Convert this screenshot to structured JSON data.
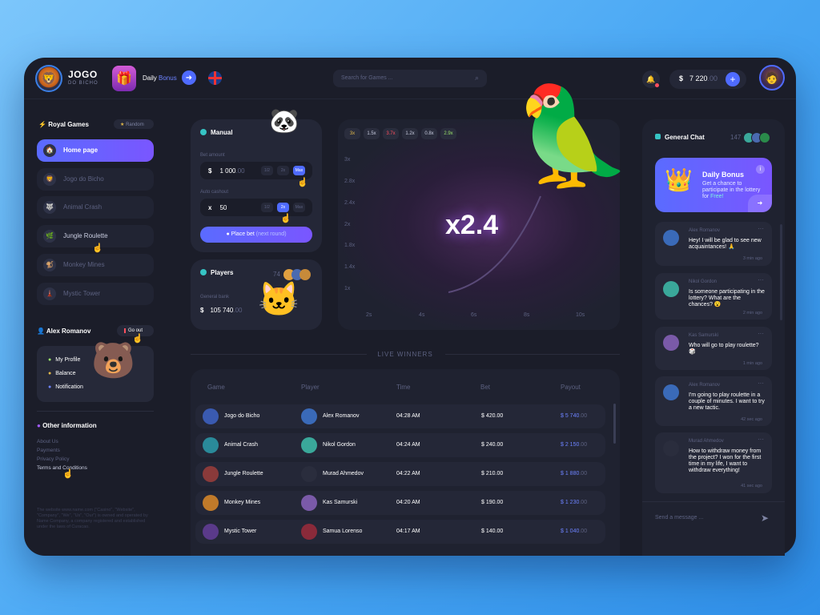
{
  "brand": {
    "title": "JOGO",
    "subtitle": "DO BICHO"
  },
  "topbar": {
    "daily_prefix": "Daily",
    "daily_bonus": "Bonus",
    "search_placeholder": "Search for Games ...",
    "currency": "$",
    "balance_main": "7 220",
    "balance_dec": ".00"
  },
  "sidebar": {
    "section_title": "Royal Games",
    "random_label": "Random",
    "items": [
      {
        "label": "Home page",
        "icon": "home-icon"
      },
      {
        "label": "Jogo do Bicho",
        "icon": "game-icon"
      },
      {
        "label": "Animal Crash",
        "icon": "game-icon"
      },
      {
        "label": "Jungle Roulette",
        "icon": "game-icon"
      },
      {
        "label": "Monkey Mines",
        "icon": "game-icon"
      },
      {
        "label": "Mystic Tower",
        "icon": "game-icon"
      }
    ],
    "user_name": "Alex Romanov",
    "go_out": "Go out",
    "profile": [
      "My Profile",
      "Balance",
      "Notification"
    ],
    "other_title": "Other information",
    "links": [
      "About Us",
      "Payments",
      "Privacy Policy",
      "Terms and Conditions"
    ],
    "legal": "The website www.name.com (\"Casino\", \"Website\", \"Company\", \"We\", \"Us\", \"Our\") is owned and operated by Name Company, a company registered and established under the laws of Curacao."
  },
  "manual": {
    "title": "Manual",
    "bet_label": "Bet amount",
    "bet_symbol": "$",
    "bet_value": "1 000",
    "bet_dec": ".00",
    "bet_chips": [
      "1/2",
      "2x",
      "Max"
    ],
    "cash_label": "Auto cashout",
    "cash_symbol": "x",
    "cash_value": "50",
    "cash_chips": [
      "1/2",
      "2x",
      "Max"
    ],
    "place_bet": "Place bet",
    "next_round": "(next round)"
  },
  "players": {
    "title": "Players",
    "count": "74",
    "bank_label": "General bank",
    "bank_symbol": "$",
    "bank_value": "105 740",
    "bank_dec": ".00"
  },
  "game": {
    "history": [
      "3x",
      "1.5x",
      "3.7x",
      "1.2x",
      "0.8x",
      "2.9x"
    ],
    "history_colors": [
      "#e0b84a",
      "#5c6180",
      "#ff4f5e",
      "#5c6180",
      "#5c6180",
      "#9be36b"
    ],
    "y_labels": [
      "3x",
      "2.8x",
      "2.4x",
      "2x",
      "1.8x",
      "1.4x",
      "1x"
    ],
    "x_labels": [
      "2s",
      "4s",
      "6s",
      "8s",
      "10s"
    ],
    "multiplier": "x2.4"
  },
  "live_winners": {
    "title": "LIVE WINNERS",
    "headers": [
      "Game",
      "Player",
      "Time",
      "Bet",
      "Payout"
    ],
    "rows": [
      {
        "game": "Jogo do Bicho",
        "player": "Alex Romanov",
        "time": "04:28 AM",
        "bet": "$ 420.00",
        "payout": "$ 5 740",
        "payout_dec": ".00"
      },
      {
        "game": "Animal Crash",
        "player": "Nikol Gordon",
        "time": "04:24 AM",
        "bet": "$ 240.00",
        "payout": "$ 2 150",
        "payout_dec": ".00"
      },
      {
        "game": "Jungle Roulette",
        "player": "Murad Ahmedov",
        "time": "04:22 AM",
        "bet": "$ 210.00",
        "payout": "$ 1 880",
        "payout_dec": ".00"
      },
      {
        "game": "Monkey Mines",
        "player": "Kas Samurski",
        "time": "04:20 AM",
        "bet": "$ 190.00",
        "payout": "$ 1 230",
        "payout_dec": ".00"
      },
      {
        "game": "Mystic Tower",
        "player": "Samua Lorenso",
        "time": "04:17 AM",
        "bet": "$ 140.00",
        "payout": "$ 1 040",
        "payout_dec": ".00"
      }
    ]
  },
  "chat": {
    "title": "General Chat",
    "count": "147",
    "bonus_title": "Daily Bonus",
    "bonus_text": "Get a chance to participate in the lottery for",
    "bonus_free": "Free!",
    "messages": [
      {
        "name": "Alex Romanov",
        "text": "Hey! I will be glad to see new acquaintances! 🙏",
        "time": "3 min ago"
      },
      {
        "name": "Nikol Gordon",
        "text": "Is someone participating in the lottery? What are the chances? 😮",
        "time": "2 min ago"
      },
      {
        "name": "Kas Samurski",
        "text": "Who will go to play roulette? 🎲",
        "time": "1 min ago"
      },
      {
        "name": "Alex Romanov",
        "text": "I'm going to play roulette in a couple of minutes. I want to try a new tactic.",
        "time": "42 sec ago"
      },
      {
        "name": "Murad Ahmedov",
        "text": "How to withdraw money from the project? I won for the first time in my life, I want to withdraw everything!",
        "time": "41 sec ago"
      }
    ],
    "send_placeholder": "Send a message ..."
  }
}
